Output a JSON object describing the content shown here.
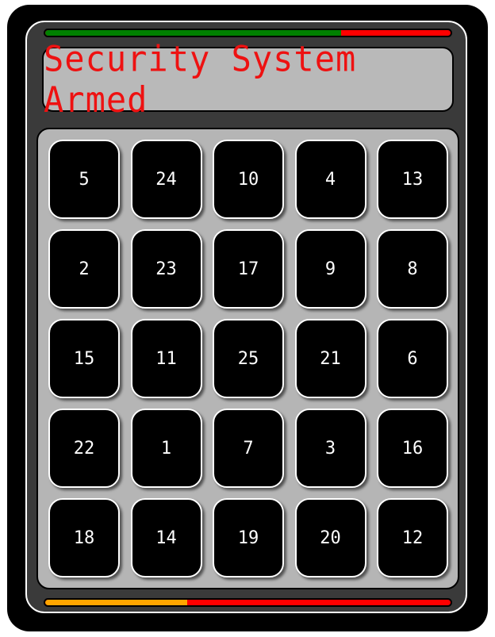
{
  "display": {
    "text": "Security System Armed",
    "color": "#ee1111"
  },
  "top_bar": {
    "fill_color": "#008000",
    "rest_color": "#ff0000",
    "fill_fraction": 0.73
  },
  "bottom_bar": {
    "fill_color": "#ffa500",
    "rest_color": "#ff0000",
    "fill_fraction": 0.35
  },
  "keys": [
    "5",
    "24",
    "10",
    "4",
    "13",
    "2",
    "23",
    "17",
    "9",
    "8",
    "15",
    "11",
    "25",
    "21",
    "6",
    "22",
    "1",
    "7",
    "3",
    "16",
    "18",
    "14",
    "19",
    "20",
    "12"
  ]
}
